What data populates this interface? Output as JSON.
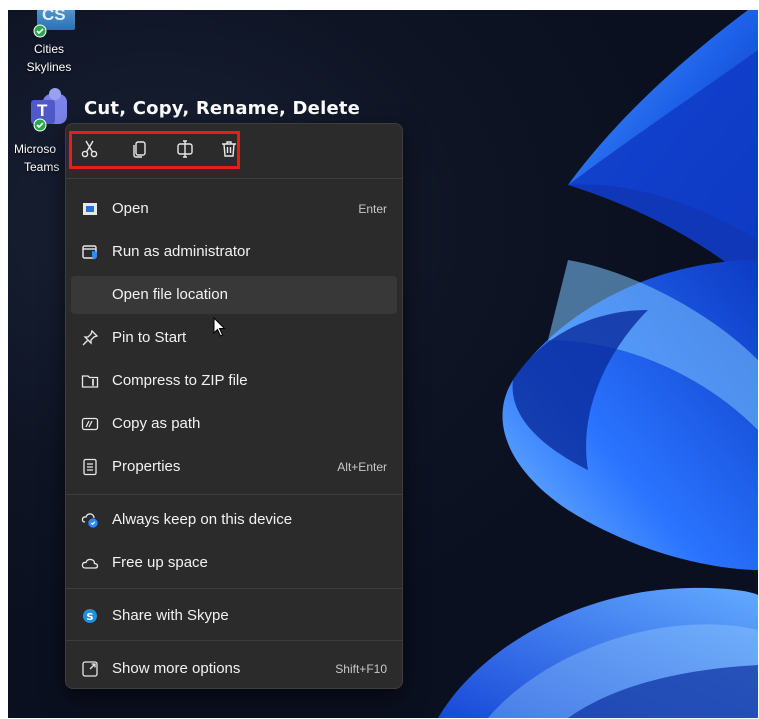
{
  "desktop_icons": [
    {
      "label_line1": "Cities",
      "label_line2": "Skylines",
      "logo": "CS"
    },
    {
      "label_line1": "Microso",
      "label_line2": "Teams",
      "logo": "T"
    }
  ],
  "annotation": "Cut, Copy, Rename, Delete",
  "quick_actions": [
    {
      "name": "cut",
      "icon": "scissors-icon"
    },
    {
      "name": "copy",
      "icon": "copy-icon"
    },
    {
      "name": "rename",
      "icon": "rename-icon"
    },
    {
      "name": "delete",
      "icon": "trash-icon"
    }
  ],
  "menu": {
    "items": [
      {
        "label": "Open",
        "shortcut": "Enter",
        "icon": "open-icon"
      },
      {
        "label": "Run as administrator",
        "shortcut": "",
        "icon": "shield-window-icon"
      },
      {
        "label": "Open file location",
        "shortcut": "",
        "icon": ""
      },
      {
        "label": "Pin to Start",
        "shortcut": "",
        "icon": "pin-icon"
      },
      {
        "label": "Compress to ZIP file",
        "shortcut": "",
        "icon": "zip-icon"
      },
      {
        "label": "Copy as path",
        "shortcut": "",
        "icon": "path-icon"
      },
      {
        "label": "Properties",
        "shortcut": "Alt+Enter",
        "icon": "properties-icon"
      },
      {
        "label": "Always keep on this device",
        "shortcut": "",
        "icon": "cloud-sync-icon"
      },
      {
        "label": "Free up space",
        "shortcut": "",
        "icon": "cloud-icon"
      },
      {
        "label": "Share with Skype",
        "shortcut": "",
        "icon": "skype-icon"
      },
      {
        "label": "Show more options",
        "shortcut": "Shift+F10",
        "icon": "more-options-icon"
      }
    ]
  },
  "colors": {
    "highlight_box": "#e0201b",
    "menu_bg": "#2b2b2b",
    "accent_blue": "#1e6bff",
    "skype_blue": "#1e90e0"
  }
}
